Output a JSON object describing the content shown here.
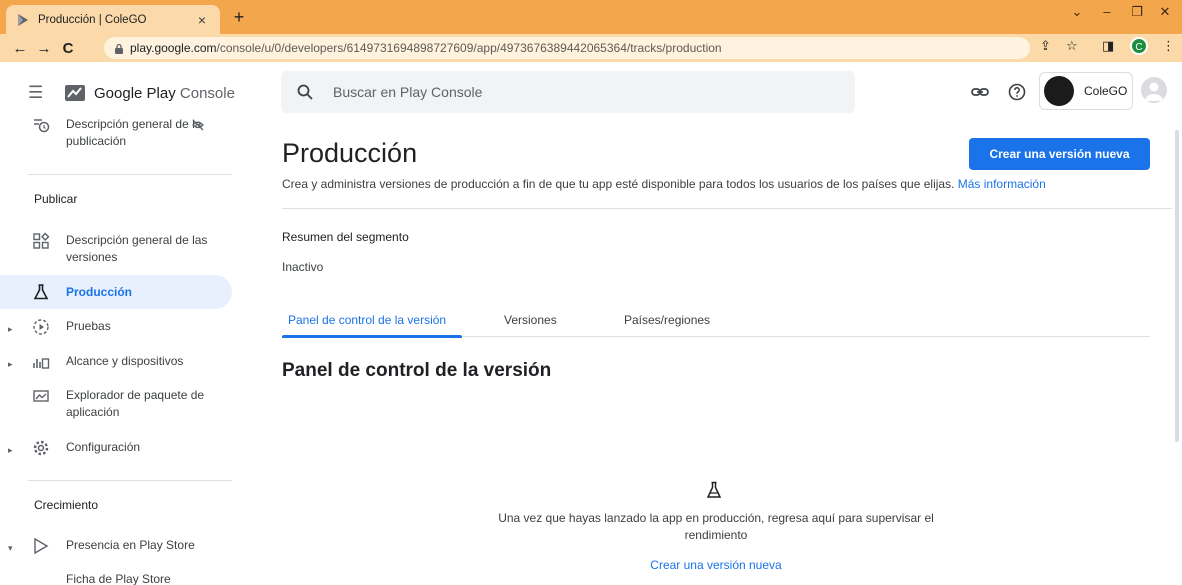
{
  "browser": {
    "tab_title": "Producción | ColeGO",
    "tab_close": "×",
    "new_tab": "+",
    "url_host": "play.google.com",
    "url_path": "/console/u/0/developers/6149731694898727609/app/4973676389442065364/tracks/production",
    "profile_initial": "C",
    "window_controls": [
      "⌄",
      "–",
      "❐",
      "✕"
    ],
    "nav": {
      "back": "←",
      "forward": "→",
      "reload": "C"
    },
    "toolbar_right": [
      "⇪",
      "☆",
      "◨",
      "⋮"
    ]
  },
  "sidebar": {
    "brand": "Google Play",
    "brand_suffix": "Console",
    "items_top": [
      {
        "label": "Descripción general de la publicación",
        "icon": "publishing-overview-icon"
      }
    ],
    "section_publish": "Publicar",
    "items_publish": [
      {
        "label": "Descripción general de las versiones",
        "icon": "release-overview-icon",
        "expand": ""
      },
      {
        "label": "Producción",
        "icon": "production-icon",
        "expand": "",
        "active": true
      },
      {
        "label": "Pruebas",
        "icon": "testing-icon",
        "expand": "▸"
      },
      {
        "label": "Alcance y dispositivos",
        "icon": "reach-devices-icon",
        "expand": "▸"
      },
      {
        "label": "Explorador de paquete de aplicación",
        "icon": "bundle-explorer-icon",
        "expand": ""
      },
      {
        "label": "Configuración",
        "icon": "setup-gear-icon",
        "expand": "▸"
      }
    ],
    "section_growth": "Crecimiento",
    "items_growth": [
      {
        "label": "Presencia en Play Store",
        "icon": "store-presence-icon",
        "expand": "▾"
      },
      {
        "label": "Ficha de Play Store",
        "icon": "",
        "expand": ""
      }
    ]
  },
  "topbar": {
    "search_placeholder": "Buscar en Play Console",
    "account_name": "ColeGO"
  },
  "main": {
    "title": "Producción",
    "cta_label": "Crear una versión nueva",
    "description": "Crea y administra versiones de producción a fin de que tu app esté disponible para todos los usuarios de los países que elijas.",
    "more_info": "Más información",
    "segment_title": "Resumen del segmento",
    "segment_status": "Inactivo",
    "tabs": [
      "Panel de control de la versión",
      "Versiones",
      "Países/regiones"
    ],
    "section_title": "Panel de control de la versión",
    "empty_message": "Una vez que hayas lanzado la app en producción, regresa aquí para supervisar el rendimiento",
    "empty_link": "Crear una versión nueva"
  },
  "colors": {
    "accent": "#1a73e8",
    "active_bg": "#e8f0fe",
    "tab_strip": "#f4a64c",
    "toolbar": "#fbd9a8"
  }
}
